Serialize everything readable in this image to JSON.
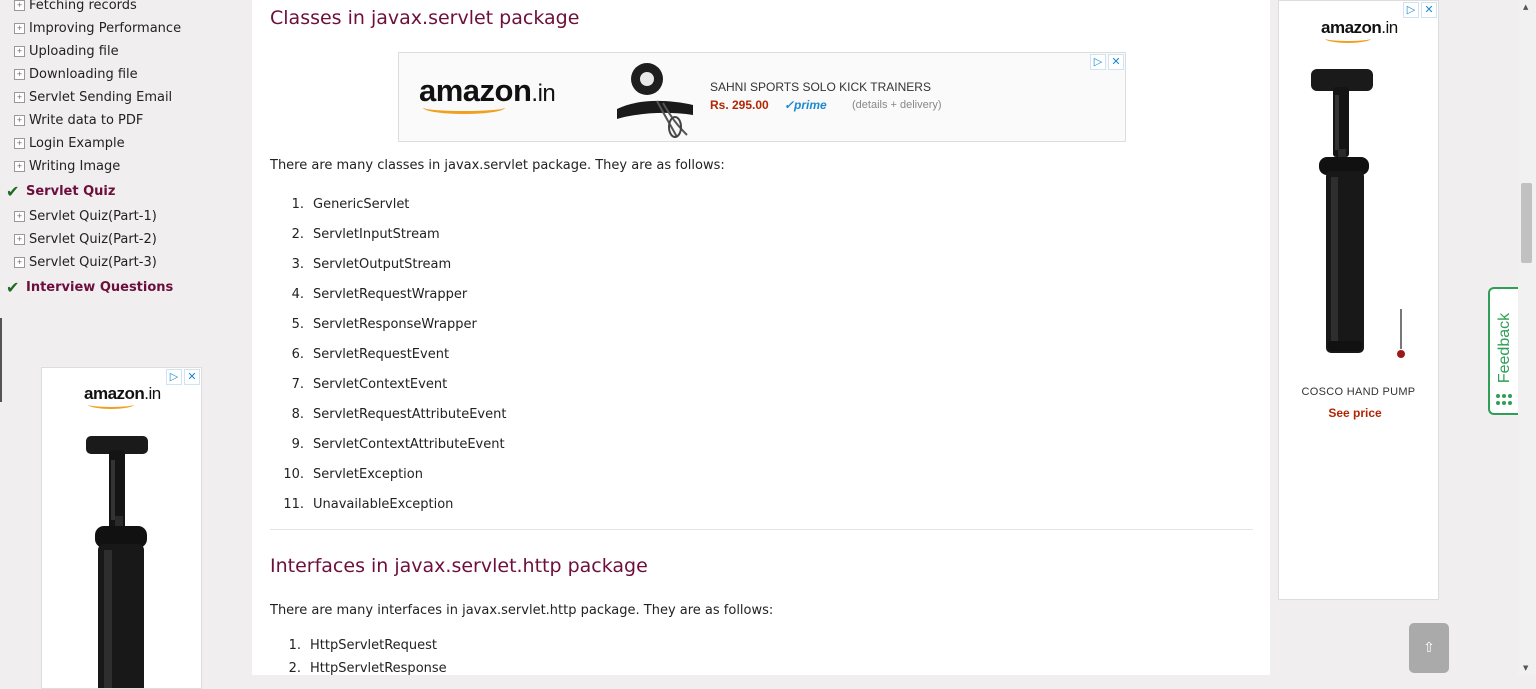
{
  "sidebar": {
    "items_group1": [
      {
        "label": "Fetching records"
      },
      {
        "label": "Improving Performance"
      },
      {
        "label": "Uploading file"
      },
      {
        "label": "Downloading file"
      },
      {
        "label": "Servlet Sending Email"
      },
      {
        "label": "Write data to PDF"
      },
      {
        "label": "Login Example"
      },
      {
        "label": "Writing Image"
      }
    ],
    "head_quiz": "Servlet Quiz",
    "items_group2": [
      {
        "label": "Servlet Quiz(Part-1)"
      },
      {
        "label": "Servlet Quiz(Part-2)"
      },
      {
        "label": "Servlet Quiz(Part-3)"
      }
    ],
    "head_interview": "Interview Questions",
    "expand_icon": "plus-box-icon",
    "check_icon": "checkmark-icon"
  },
  "ads": {
    "left": {
      "logo": "amazon",
      "logo_suffix": ".in"
    },
    "top": {
      "logo": "amazon",
      "logo_suffix": ".in",
      "product": "SAHNI SPORTS SOLO KICK TRAINERS",
      "price": "Rs. 295.00",
      "prime": "✓prime",
      "details": "(details + delivery)"
    },
    "right": {
      "logo": "amazon",
      "logo_suffix": ".in",
      "product": "COSCO HAND PUMP",
      "cta": "See price"
    },
    "adchoices_icon": "▷",
    "close_icon": "✕"
  },
  "main": {
    "section1": {
      "title": "Classes in javax.servlet package",
      "intro": "There are many classes in javax.servlet package. They are as follows:",
      "items": [
        {
          "num": "1.",
          "text": "GenericServlet"
        },
        {
          "num": "2.",
          "text": "ServletInputStream"
        },
        {
          "num": "3.",
          "text": "ServletOutputStream"
        },
        {
          "num": "4.",
          "text": "ServletRequestWrapper"
        },
        {
          "num": "5.",
          "text": "ServletResponseWrapper"
        },
        {
          "num": "6.",
          "text": "ServletRequestEvent"
        },
        {
          "num": "7.",
          "text": "ServletContextEvent"
        },
        {
          "num": "8.",
          "text": "ServletRequestAttributeEvent"
        },
        {
          "num": "9.",
          "text": "ServletContextAttributeEvent"
        },
        {
          "num": "10.",
          "text": "ServletException"
        },
        {
          "num": "11.",
          "text": "UnavailableException"
        }
      ]
    },
    "section2": {
      "title": "Interfaces in javax.servlet.http package",
      "intro": "There are many interfaces in javax.servlet.http package. They are as follows:",
      "items": [
        {
          "num": "1.",
          "text": "HttpServletRequest"
        },
        {
          "num": "2.",
          "text": "HttpServletResponse"
        }
      ]
    }
  },
  "feedback": {
    "label": "Feedback"
  },
  "scroll_top": {
    "label": "⇧"
  },
  "colors": {
    "heading": "#6d0f3c",
    "feedback": "#2f9e56",
    "price": "#b12704",
    "prime": "#1a8ad1"
  }
}
